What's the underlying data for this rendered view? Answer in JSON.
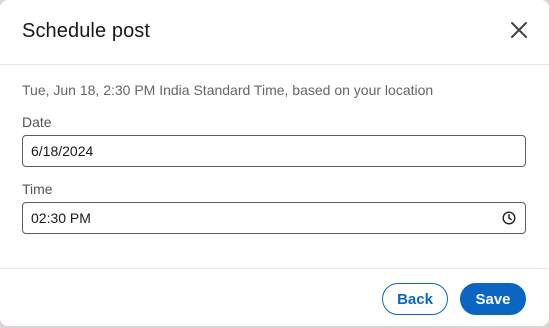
{
  "dialog": {
    "title": "Schedule post",
    "close_icon": "close-icon"
  },
  "body": {
    "timezone_note": "Tue, Jun 18, 2:30 PM India Standard Time, based on your location",
    "date": {
      "label": "Date",
      "value": "6/18/2024"
    },
    "time": {
      "label": "Time",
      "value": "02:30 PM",
      "icon": "clock-icon"
    }
  },
  "footer": {
    "back_label": "Back",
    "save_label": "Save"
  },
  "colors": {
    "accent": "#0a66c2",
    "text_primary": "#191919",
    "text_secondary": "#666666"
  }
}
